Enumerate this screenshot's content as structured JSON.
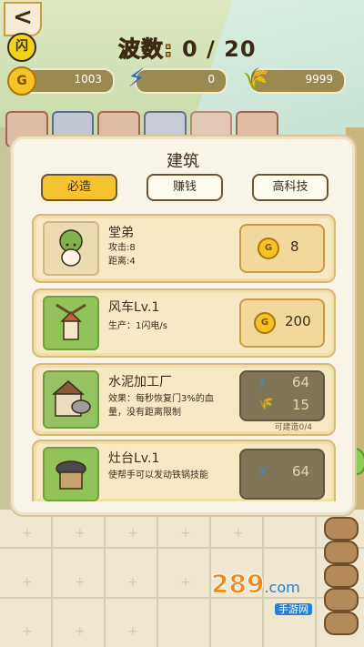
{
  "hud": {
    "back_glyph": "<",
    "flash_label": "闪",
    "wave_label": "波数:",
    "wave_value": "0 / 20",
    "coins": "1003",
    "energy": "0",
    "wheat": "9999"
  },
  "modal": {
    "title": "建筑",
    "tabs": [
      {
        "label": "必造",
        "active": true
      },
      {
        "label": "赚钱",
        "active": false
      },
      {
        "label": "高科技",
        "active": false
      }
    ],
    "items": [
      {
        "name": "堂弟",
        "desc": "攻击:8\n距离:4",
        "price_coin": "8"
      },
      {
        "name": "风车Lv.1",
        "desc": "生产：1闪电/s",
        "price_coin": "200"
      },
      {
        "name": "水泥加工厂",
        "desc": "效果：每秒恢复门3%的血\n量，没有距离限制",
        "price_energy": "64",
        "price_wheat": "15",
        "buildable": "可建造0/4"
      },
      {
        "name": "灶台Lv.1",
        "desc": "使帮手可以发动铁锅技能",
        "price_energy": "64"
      }
    ]
  },
  "watermark": {
    "num": "289",
    "com": ".com",
    "sub": "手游网"
  },
  "colors": {
    "accent": "#f5c230",
    "panel": "#f8f4e8",
    "item_bg": "#f7e9c4",
    "energy": "#3e8de0"
  }
}
